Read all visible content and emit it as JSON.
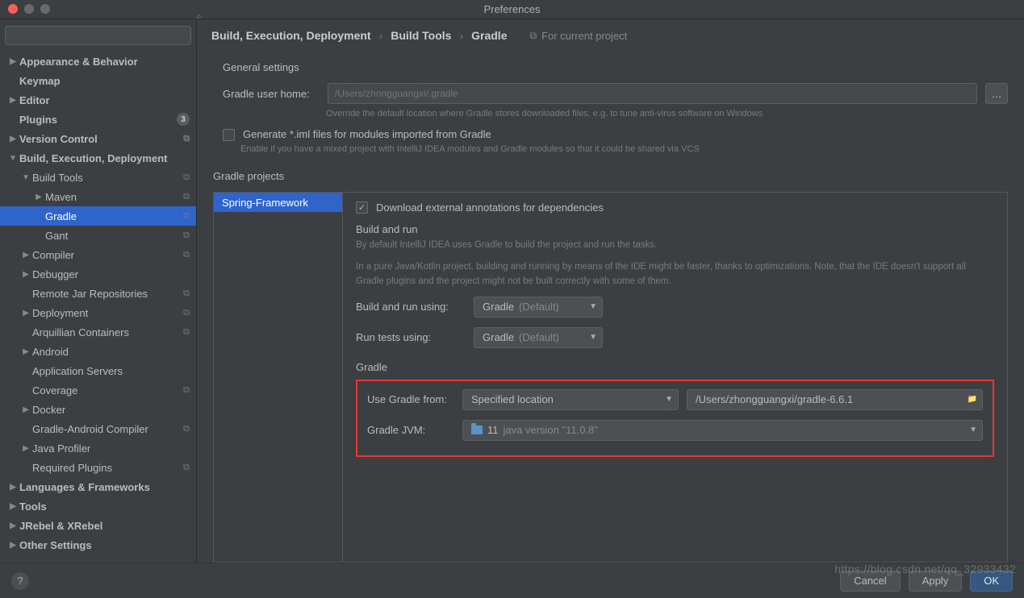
{
  "window_title": "Preferences",
  "breadcrumb": {
    "a": "Build, Execution, Deployment",
    "b": "Build Tools",
    "c": "Gradle",
    "proj_note": "For current project"
  },
  "sidebar": {
    "items": [
      {
        "label": "Appearance & Behavior",
        "bold": true,
        "indent": 0,
        "arrow": "▶"
      },
      {
        "label": "Keymap",
        "bold": true,
        "indent": 0,
        "arrow": ""
      },
      {
        "label": "Editor",
        "bold": true,
        "indent": 0,
        "arrow": "▶"
      },
      {
        "label": "Plugins",
        "bold": true,
        "indent": 0,
        "arrow": "",
        "badge": "3"
      },
      {
        "label": "Version Control",
        "bold": true,
        "indent": 0,
        "arrow": "▶",
        "copy": true
      },
      {
        "label": "Build, Execution, Deployment",
        "bold": true,
        "indent": 0,
        "arrow": "▼"
      },
      {
        "label": "Build Tools",
        "bold": false,
        "indent": 1,
        "arrow": "▼",
        "copy": true
      },
      {
        "label": "Maven",
        "bold": false,
        "indent": 2,
        "arrow": "▶",
        "copy": true
      },
      {
        "label": "Gradle",
        "bold": false,
        "indent": 2,
        "arrow": "",
        "copy": true,
        "selected": true
      },
      {
        "label": "Gant",
        "bold": false,
        "indent": 2,
        "arrow": "",
        "copy": true
      },
      {
        "label": "Compiler",
        "bold": false,
        "indent": 1,
        "arrow": "▶",
        "copy": true
      },
      {
        "label": "Debugger",
        "bold": false,
        "indent": 1,
        "arrow": "▶"
      },
      {
        "label": "Remote Jar Repositories",
        "bold": false,
        "indent": 1,
        "arrow": "",
        "copy": true
      },
      {
        "label": "Deployment",
        "bold": false,
        "indent": 1,
        "arrow": "▶",
        "copy": true
      },
      {
        "label": "Arquillian Containers",
        "bold": false,
        "indent": 1,
        "arrow": "",
        "copy": true
      },
      {
        "label": "Android",
        "bold": false,
        "indent": 1,
        "arrow": "▶"
      },
      {
        "label": "Application Servers",
        "bold": false,
        "indent": 1,
        "arrow": ""
      },
      {
        "label": "Coverage",
        "bold": false,
        "indent": 1,
        "arrow": "",
        "copy": true
      },
      {
        "label": "Docker",
        "bold": false,
        "indent": 1,
        "arrow": "▶"
      },
      {
        "label": "Gradle-Android Compiler",
        "bold": false,
        "indent": 1,
        "arrow": "",
        "copy": true
      },
      {
        "label": "Java Profiler",
        "bold": false,
        "indent": 1,
        "arrow": "▶"
      },
      {
        "label": "Required Plugins",
        "bold": false,
        "indent": 1,
        "arrow": "",
        "copy": true
      },
      {
        "label": "Languages & Frameworks",
        "bold": true,
        "indent": 0,
        "arrow": "▶"
      },
      {
        "label": "Tools",
        "bold": true,
        "indent": 0,
        "arrow": "▶"
      },
      {
        "label": "JRebel & XRebel",
        "bold": true,
        "indent": 0,
        "arrow": "▶"
      },
      {
        "label": "Other Settings",
        "bold": true,
        "indent": 0,
        "arrow": "▶"
      }
    ]
  },
  "general": {
    "title": "General settings",
    "user_home_label": "Gradle user home:",
    "user_home_value": "/Users/zhongguangxi/.gradle",
    "user_home_help": "Override the default location where Gradle stores downloaded files, e.g. to tune anti-virus software on Windows",
    "gen_iml_label": "Generate *.iml files for modules imported from Gradle",
    "gen_iml_help": "Enable if you have a mixed project with IntelliJ IDEA modules and Gradle modules so that it could be shared via VCS"
  },
  "projects": {
    "title": "Gradle projects",
    "items": [
      "Spring-Framework"
    ],
    "download_label": "Download external annotations for dependencies",
    "build_run_title": "Build and run",
    "build_run_help1": "By default IntelliJ IDEA uses Gradle to build the project and run the tasks.",
    "build_run_help2": "In a pure Java/Kotlin project, building and running by means of the IDE might be faster, thanks to optimizations. Note, that the IDE doesn't support all Gradle plugins and the project might not be built correctly with some of them.",
    "build_using_label": "Build and run using:",
    "build_using_value": "Gradle",
    "build_using_suffix": "(Default)",
    "tests_using_label": "Run tests using:",
    "tests_using_value": "Gradle",
    "tests_using_suffix": "(Default)",
    "gradle_section": "Gradle",
    "use_gradle_from_label": "Use Gradle from:",
    "use_gradle_from_value": "Specified location",
    "gradle_location": "/Users/zhongguangxi/gradle-6.6.1",
    "jvm_label": "Gradle JVM:",
    "jvm_value": "11",
    "jvm_detail": "java version \"11.0.8\""
  },
  "footer": {
    "cancel": "Cancel",
    "apply": "Apply",
    "ok": "OK"
  },
  "watermark": "https://blog.csdn.net/qq_32933432"
}
